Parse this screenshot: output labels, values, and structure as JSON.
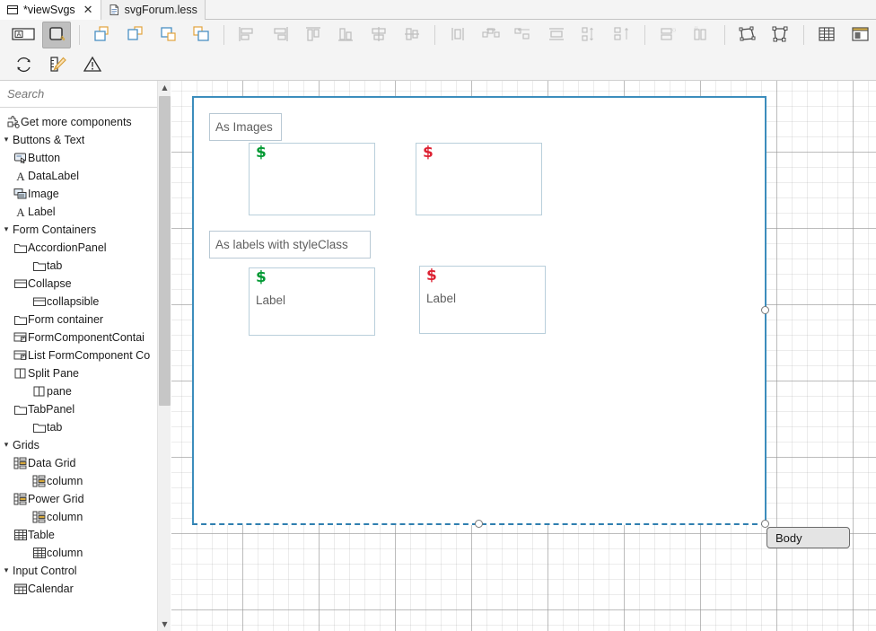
{
  "window": {
    "tabs": [
      {
        "label": "*viewSvgs",
        "icon": "window-icon",
        "active": true,
        "closable": true
      },
      {
        "label": "svgForum.less",
        "icon": "file-icon",
        "active": false,
        "closable": false
      }
    ]
  },
  "toolbar": {
    "row1": [
      {
        "name": "label-tool",
        "icon": "label-box-icon",
        "selected": false,
        "enabled": true
      },
      {
        "name": "select-tool",
        "icon": "rounded-square-icon",
        "selected": true,
        "enabled": true
      },
      {
        "name": "separator",
        "icon": "separator"
      },
      {
        "name": "bring-forward",
        "icon": "layer-forward-icon",
        "enabled": true
      },
      {
        "name": "send-backward",
        "icon": "layer-backward-icon",
        "enabled": true
      },
      {
        "name": "bring-to-front",
        "icon": "layer-front-icon",
        "enabled": true
      },
      {
        "name": "send-to-back",
        "icon": "layer-back-icon",
        "enabled": true
      },
      {
        "name": "separator",
        "icon": "separator"
      },
      {
        "name": "align-left",
        "icon": "align-left-icon",
        "enabled": false
      },
      {
        "name": "align-right",
        "icon": "align-right-icon",
        "enabled": false
      },
      {
        "name": "align-top",
        "icon": "align-top-icon",
        "enabled": false
      },
      {
        "name": "align-bottom",
        "icon": "align-bottom-icon",
        "enabled": false
      },
      {
        "name": "align-center-horizontal",
        "icon": "align-center-h-icon",
        "enabled": false
      },
      {
        "name": "align-center-vertical",
        "icon": "align-center-v-icon",
        "enabled": false
      },
      {
        "name": "separator",
        "icon": "separator"
      },
      {
        "name": "match-width",
        "icon": "match-width-icon",
        "enabled": false
      },
      {
        "name": "distribute-horizontal",
        "icon": "distribute-h-icon",
        "enabled": false
      },
      {
        "name": "distribute-left",
        "icon": "distribute-left-icon",
        "enabled": false
      },
      {
        "name": "match-height",
        "icon": "match-height-icon",
        "enabled": false
      },
      {
        "name": "distribute-vertical",
        "icon": "distribute-v-icon",
        "enabled": false
      },
      {
        "name": "distribute-stack",
        "icon": "distribute-stack-icon",
        "enabled": false
      },
      {
        "name": "separator",
        "icon": "separator"
      },
      {
        "name": "group-rows",
        "icon": "group-rows-icon",
        "enabled": false
      },
      {
        "name": "group-columns",
        "icon": "group-columns-icon",
        "enabled": false
      },
      {
        "name": "separator",
        "icon": "separator"
      },
      {
        "name": "resize-to-content",
        "icon": "resize-content-icon",
        "enabled": true
      },
      {
        "name": "fit-to-frame",
        "icon": "fit-frame-icon",
        "enabled": true
      },
      {
        "name": "separator",
        "icon": "separator"
      },
      {
        "name": "show-grid",
        "icon": "table-grid-icon",
        "enabled": true
      },
      {
        "name": "show-panel",
        "icon": "panel-icon",
        "enabled": true
      }
    ],
    "row2": [
      {
        "name": "refresh",
        "icon": "refresh-icon",
        "enabled": true
      },
      {
        "name": "edit-style",
        "icon": "pencil-ruler-icon",
        "enabled": true
      },
      {
        "name": "problems",
        "icon": "warning-triangle-icon",
        "enabled": true
      }
    ]
  },
  "palette": {
    "search": {
      "placeholder": "Search",
      "value": ""
    },
    "get_more": {
      "label": "Get more components",
      "icon": "puzzle-icon"
    },
    "tree": [
      {
        "level": 0,
        "label": "Buttons & Text",
        "icon": "none",
        "twist": "expanded",
        "group": true
      },
      {
        "level": 1,
        "label": "Button",
        "icon": "button-icon"
      },
      {
        "level": 1,
        "label": "DataLabel",
        "icon": "letter-a-icon"
      },
      {
        "level": 1,
        "label": "Image",
        "icon": "image-icon"
      },
      {
        "level": 1,
        "label": "Label",
        "icon": "letter-a-icon"
      },
      {
        "level": 0,
        "label": "Form Containers",
        "icon": "none",
        "twist": "expanded",
        "group": true
      },
      {
        "level": 1,
        "label": "AccordionPanel",
        "icon": "folder-icon"
      },
      {
        "level": 2,
        "label": "tab",
        "icon": "folder-icon"
      },
      {
        "level": 1,
        "label": "Collapse",
        "icon": "panel-box-icon"
      },
      {
        "level": 2,
        "label": "collapsible",
        "icon": "panel-box-icon"
      },
      {
        "level": 1,
        "label": "Form container",
        "icon": "folder-icon"
      },
      {
        "level": 1,
        "label": "FormComponentContai",
        "icon": "form-component-icon"
      },
      {
        "level": 1,
        "label": "List FormComponent Co",
        "icon": "form-component-icon"
      },
      {
        "level": 1,
        "label": "Split Pane",
        "icon": "split-pane-icon"
      },
      {
        "level": 2,
        "label": "pane",
        "icon": "split-pane-icon"
      },
      {
        "level": 1,
        "label": "TabPanel",
        "icon": "folder-icon"
      },
      {
        "level": 2,
        "label": "tab",
        "icon": "folder-icon"
      },
      {
        "level": 0,
        "label": "Grids",
        "icon": "none",
        "twist": "expanded",
        "group": true
      },
      {
        "level": 1,
        "label": "Data Grid",
        "icon": "datagrid-icon"
      },
      {
        "level": 2,
        "label": "column",
        "icon": "datagrid-icon"
      },
      {
        "level": 1,
        "label": "Power Grid",
        "icon": "datagrid-icon"
      },
      {
        "level": 2,
        "label": "column",
        "icon": "datagrid-icon"
      },
      {
        "level": 1,
        "label": "Table",
        "icon": "table-icon"
      },
      {
        "level": 2,
        "label": "column",
        "icon": "table-icon"
      },
      {
        "level": 0,
        "label": "Input Control",
        "icon": "none",
        "twist": "expanded",
        "group": true
      },
      {
        "level": 1,
        "label": "Calendar",
        "icon": "calendar-icon"
      }
    ],
    "scrollbar": {
      "up": "▲",
      "down": "▼"
    }
  },
  "canvas": {
    "selected_form": "Body",
    "tooltip_label": "Body",
    "items": [
      {
        "kind": "label",
        "name": "as-images-label",
        "text": "As Images"
      },
      {
        "kind": "image",
        "name": "image-green-dollar",
        "glyph": "$",
        "color": "#009933",
        "text": ""
      },
      {
        "kind": "image",
        "name": "image-red-dollar",
        "glyph": "$",
        "color": "#dd2233",
        "text": ""
      },
      {
        "kind": "label",
        "name": "as-labels-styleclass-label",
        "text": "As labels with styleClass"
      },
      {
        "kind": "label-with-icon",
        "name": "label-green-dollar",
        "glyph": "$",
        "color": "#009933",
        "text": "Label"
      },
      {
        "kind": "label-with-icon",
        "name": "label-red-dollar",
        "glyph": "$",
        "color": "#dd2233",
        "text": "Label"
      }
    ]
  },
  "colors": {
    "selection_border": "#3c8dbc",
    "component_border": "#b9c9d4",
    "green": "#009933",
    "red": "#dd2233",
    "toolbar_bg": "#f4f4f4"
  }
}
